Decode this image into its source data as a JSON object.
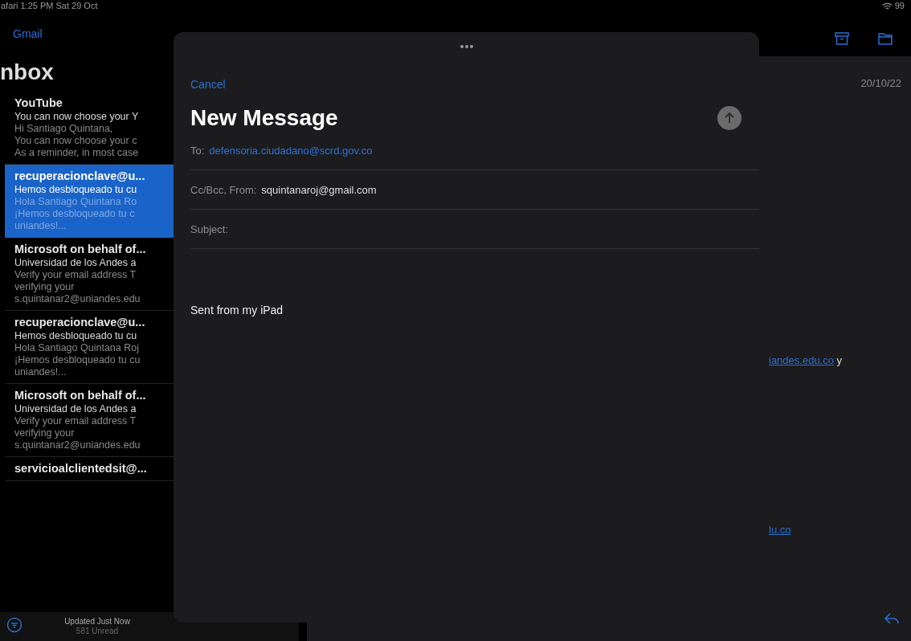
{
  "status_bar": {
    "left": "afari  1:25 PM  Sat 29 Oct",
    "battery": "99"
  },
  "sidebar": {
    "back_link": "Gmail",
    "title": "nbox",
    "messages": [
      {
        "sender": "YouTube",
        "subject": "You can now choose your Y",
        "preview_lines": [
          "Hi Santiago Quintana,",
          "You can now choose your c",
          "As a reminder, in most case"
        ],
        "selected": false
      },
      {
        "sender": "recuperacionclave@u...",
        "subject": "Hemos desbloqueado tu cu",
        "preview_lines": [
          "Hola Santiago Quintana Ro",
          "¡Hemos desbloqueado tu c",
          "uniandes!..."
        ],
        "selected": true
      },
      {
        "sender": "Microsoft on behalf of...",
        "subject": "Universidad de los Andes a",
        "preview_lines": [
          "Verify your email address T",
          "verifying your",
          "s.quintanar2@uniandes.edu"
        ],
        "selected": false
      },
      {
        "sender": "recuperacionclave@u...",
        "subject": "Hemos desbloqueado tu cu",
        "preview_lines": [
          "Hola Santiago Quintana Roj",
          "¡Hemos desbloqueado tu cu",
          "uniandes!..."
        ],
        "selected": false
      },
      {
        "sender": "Microsoft on behalf of...",
        "subject": "Universidad de los Andes a",
        "preview_lines": [
          "Verify your email address T",
          "verifying your",
          "s.quintanar2@uniandes.edu"
        ],
        "selected": false
      },
      {
        "sender": "servicioalclientedsit@...",
        "selected": false
      }
    ],
    "footer": {
      "status": "Updated Just Now",
      "count": "581 Unread"
    }
  },
  "reader": {
    "date": "20/10/22",
    "links": [
      {
        "text": "iandes.edu.co",
        "after": " y"
      },
      {
        "text": "lu.co"
      }
    ]
  },
  "compose": {
    "cancel": "Cancel",
    "title": "New Message",
    "fields": [
      {
        "label": "To:",
        "value": "defensoria.ciudadano@scrd.gov.co",
        "kind": "recipient"
      },
      {
        "label": "Cc/Bcc, From:",
        "value": "squintanaroj@gmail.com",
        "kind": "plain"
      },
      {
        "label": "Subject:",
        "kind": "plain"
      }
    ],
    "body": "Sent from my iPad"
  }
}
